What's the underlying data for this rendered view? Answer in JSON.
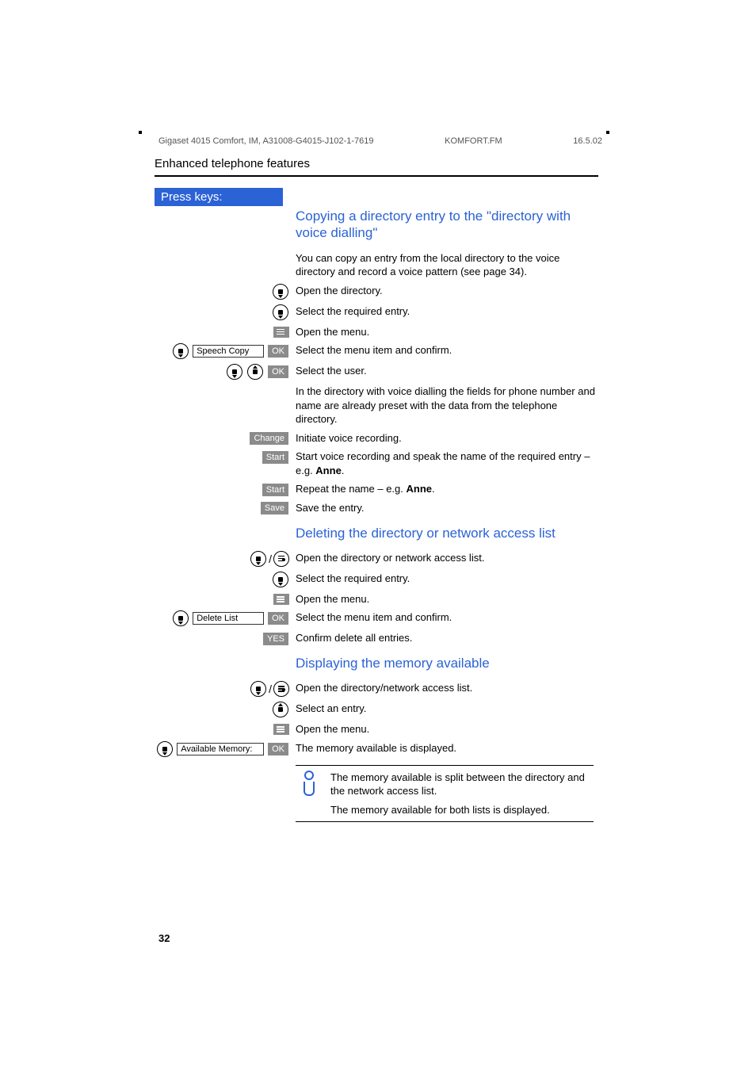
{
  "meta": {
    "doc": "Gigaset 4015 Comfort, IM, A31008-G4015-J102-1-7619",
    "file": "KOMFORT.FM",
    "date": "16.5.02"
  },
  "section": "Enhanced telephone features",
  "press_keys": "Press keys:",
  "page_num": "32",
  "h1": "Copying a directory entry to the \"directory with voice dialling\"",
  "p1": "You can copy an entry from the local directory to the voice directory and record a voice pattern (see page 34).",
  "steps1": {
    "s1": "Open the directory.",
    "s2": "Select the required entry.",
    "s3": "Open the menu.",
    "s4_item": "Speech Copy",
    "s4": "Select the menu item and confirm.",
    "s5": "Select the user.",
    "s5b": "In the directory with voice dialling the fields for phone number and name are already preset with the data from the telephone directory.",
    "s6": "Initiate voice recording.",
    "s7a": "Start voice recording and speak the name of the required entry – e.g. ",
    "s7b": "Anne",
    "s8a": "Repeat the name – e.g. ",
    "s8b": "Anne",
    "s9": "Save the entry."
  },
  "h2": "Deleting the directory or network access list",
  "steps2": {
    "s1": "Open the directory or network access list.",
    "s2": "Select the required entry.",
    "s3": "Open the menu.",
    "s4_item": "Delete List",
    "s4": "Select the menu item and confirm.",
    "s5": "Confirm delete all entries."
  },
  "h3": "Displaying the memory available",
  "steps3": {
    "s1": "Open the directory/network access list.",
    "s2": "Select an entry.",
    "s3": "Open the menu.",
    "s4_item": "Available Memory:",
    "s4": "The memory available is displayed."
  },
  "info": {
    "p1": "The memory available is split  between the directory and the network access list.",
    "p2": "The memory available for both lists is displayed."
  },
  "keys": {
    "ok": "OK",
    "change": "Change",
    "start": "Start",
    "save": "Save",
    "yes": "YES"
  }
}
